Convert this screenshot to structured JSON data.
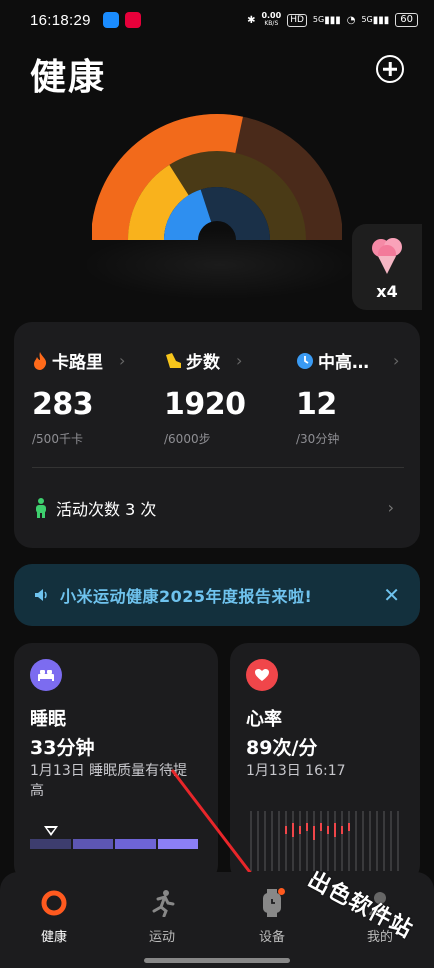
{
  "status_bar": {
    "time": "16:18:29",
    "net_speed_top": "0.00",
    "net_speed_unit": "KB/S",
    "hd_label": "HD",
    "signal_1": "5G",
    "signal_2": "5G",
    "battery": "60"
  },
  "header": {
    "title": "健康"
  },
  "rings": {
    "calories_progress": 0.566,
    "steps_progress": 0.32,
    "intensity_progress": 0.4,
    "colors": {
      "calories": "#f26a1b",
      "steps": "#f9b21c",
      "intensity": "#2e8ff0"
    }
  },
  "reward": {
    "count": "x4"
  },
  "activity": {
    "metrics": [
      {
        "label": "卡路里",
        "value": "283",
        "goal": "/500千卡",
        "icon": "flame-icon",
        "color": "#ff6a1a"
      },
      {
        "label": "步数",
        "value": "1920",
        "goal": "/6000步",
        "icon": "shoe-icon",
        "color": "#f7c51b"
      },
      {
        "label": "中高…",
        "value": "12",
        "goal": "/30分钟",
        "icon": "clock-icon",
        "color": "#3a9bf4"
      }
    ],
    "active_count_text": "活动次数 3 次"
  },
  "banner": {
    "text": "小米运动健康2025年度报告来啦!"
  },
  "sleep": {
    "title": "睡眠",
    "value": "33分钟",
    "sub": "1月13日 睡眠质量有待提高",
    "color": "#7c6cf0"
  },
  "heart": {
    "title": "心率",
    "value": "89次/分",
    "sub": "1月13日 16:17",
    "color": "#f0464a"
  },
  "nav": {
    "items": [
      {
        "label": "健康"
      },
      {
        "label": "运动"
      },
      {
        "label": "设备"
      },
      {
        "label": "我的"
      }
    ],
    "active_color": "#ff5a1f"
  },
  "watermark": {
    "text": "出色软件站"
  }
}
